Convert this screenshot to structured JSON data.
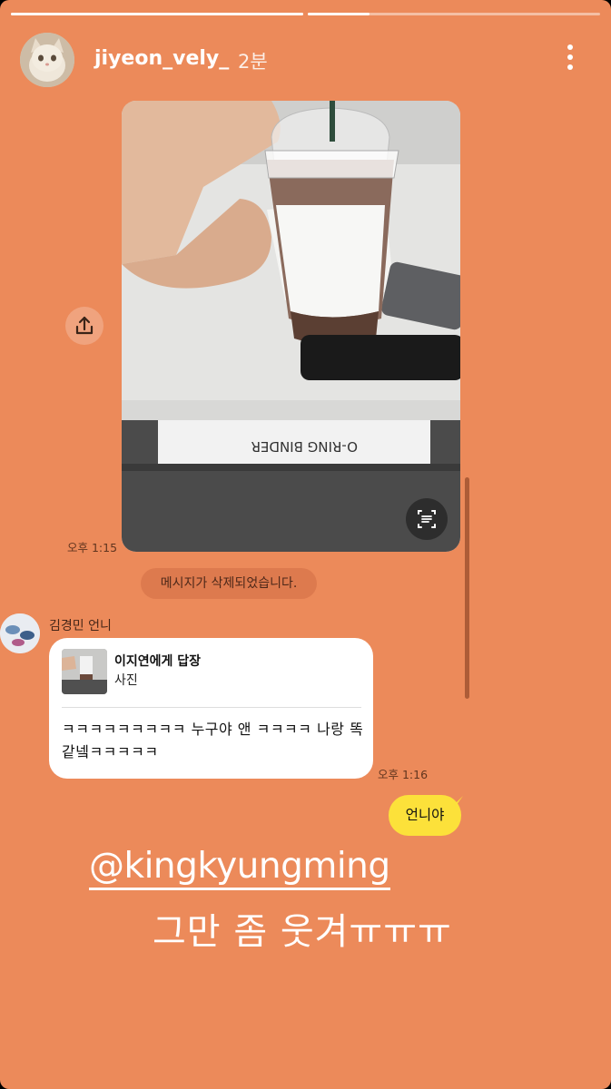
{
  "story": {
    "progress": [
      1.0,
      0.21
    ],
    "background_color": "#EC8A5A"
  },
  "header": {
    "username": "jiyeon_vely_",
    "time_ago": "2분",
    "avatar_icon": "cat-avatar-icon",
    "more_icon": "more-vertical-icon"
  },
  "chat": {
    "photo_time": "오후 1:15",
    "deleted_notice": "메시지가 삭제되었습니다.",
    "sender_name": "김경민 언니",
    "reply_title": "이지연에게 답장",
    "reply_subtitle": "사진",
    "message_text": "ㅋㅋㅋㅋㅋㅋㅋㅋㅋ 누구야  앤 ㅋㅋㅋㅋ 나랑 똑같넼ㅋㅋㅋㅋㅋ",
    "message_time": "오후 1:16",
    "my_message": "언니야",
    "my_bubble_color": "#FCE13A"
  },
  "overlay": {
    "mention": "@kingkyungming",
    "caption": "그만 좀 웃겨ㅠㅠㅠ"
  }
}
